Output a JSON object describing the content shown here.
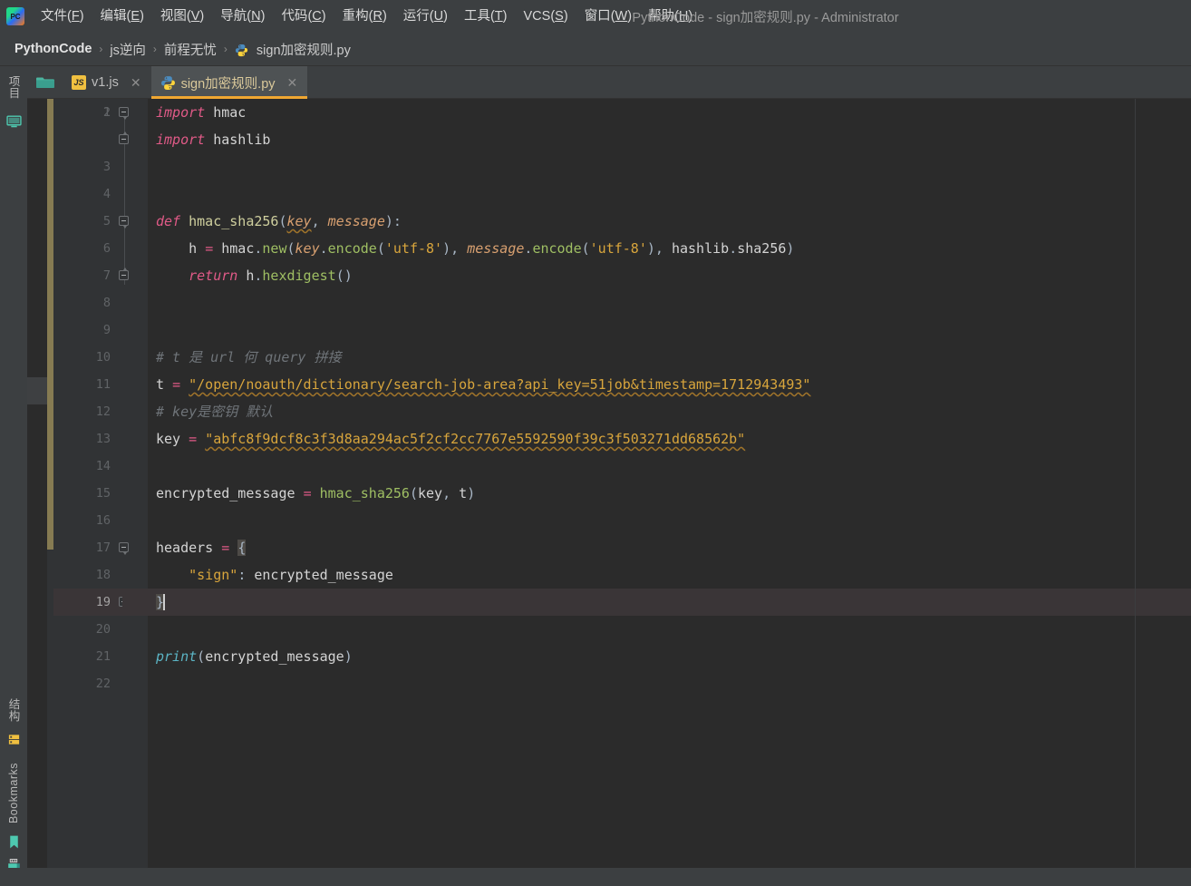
{
  "window": {
    "title": "PythonCode - sign加密规则.py - Administrator",
    "app_icon": "pycharm-logo-icon"
  },
  "menubar": {
    "items": [
      {
        "label": "文件",
        "mnemonic": "F"
      },
      {
        "label": "编辑",
        "mnemonic": "E"
      },
      {
        "label": "视图",
        "mnemonic": "V"
      },
      {
        "label": "导航",
        "mnemonic": "N"
      },
      {
        "label": "代码",
        "mnemonic": "C"
      },
      {
        "label": "重构",
        "mnemonic": "R"
      },
      {
        "label": "运行",
        "mnemonic": "U"
      },
      {
        "label": "工具",
        "mnemonic": "T"
      },
      {
        "label": "VCS",
        "mnemonic": "S"
      },
      {
        "label": "窗口",
        "mnemonic": "W"
      },
      {
        "label": "帮助",
        "mnemonic": "H"
      }
    ]
  },
  "breadcrumb": {
    "separator": "›",
    "items": [
      {
        "label": "PythonCode",
        "icon": ""
      },
      {
        "label": "js逆向",
        "icon": ""
      },
      {
        "label": "前程无忧",
        "icon": ""
      },
      {
        "label": "sign加密规则.py",
        "icon": "python-file-icon"
      }
    ]
  },
  "tabs": {
    "folder_icon": "folder-icon",
    "items": [
      {
        "label": "v1.js",
        "icon": "javascript-file-icon",
        "active": false,
        "close": "✕"
      },
      {
        "label": "sign加密规则.py",
        "icon": "python-file-icon",
        "active": true,
        "close": "✕"
      }
    ]
  },
  "left_rail": {
    "top": [
      {
        "label": "项目",
        "name": "tool-window-project"
      },
      {
        "label": "",
        "icon": "monitor-icon",
        "name": "tool-window-remote"
      }
    ],
    "bottom": [
      {
        "label": "结构",
        "name": "tool-window-structure",
        "icon": "structure-icon"
      },
      {
        "label": "Bookmarks",
        "name": "tool-window-bookmarks",
        "icon": "bookmark-icon"
      },
      {
        "label": "",
        "name": "tool-window-library",
        "icon": "books-icon"
      }
    ]
  },
  "editor": {
    "current_line": 19,
    "line_count": 22,
    "line_numbers": [
      1,
      2,
      3,
      4,
      5,
      6,
      7,
      8,
      9,
      10,
      11,
      12,
      13,
      14,
      15,
      16,
      17,
      18,
      19,
      20,
      21,
      22
    ],
    "code_lines": [
      "import hmac",
      "import hashlib",
      "",
      "",
      "def hmac_sha256(key, message):",
      "    h = hmac.new(key.encode('utf-8'), message.encode('utf-8'), hashlib.sha256)",
      "    return h.hexdigest()",
      "",
      "",
      "# t 是 url 何 query 拼接",
      "t = \"/open/noauth/dictionary/search-job-area?api_key=51job&timestamp=1712943493\"",
      "# key是密钥 默认",
      "key = \"abfc8f9dcf8c3f3d8aa294ac5f2cf2cc7767e5592590f39c3f503271dd68562b\"",
      "",
      "encrypted_message = hmac_sha256(key, t)",
      "",
      "headers = {",
      "    \"sign\": encrypted_message",
      "}",
      "",
      "print(encrypted_message)",
      ""
    ],
    "tokens": {
      "import": "import",
      "hmac": "hmac",
      "hashlib": "hashlib",
      "def": "def",
      "hmac_sha256": "hmac_sha256",
      "key_param": "key",
      "message_param": "message",
      "h_var": "h",
      "new": "new",
      "encode": "encode",
      "utf8": "'utf-8'",
      "sha256": "sha256",
      "return": "return",
      "hexdigest": "hexdigest",
      "comment_t": "# t 是 url 何 query 拼接",
      "t_var": "t",
      "url_string": "\"/open/noauth/dictionary/search-job-area?api_key=51job&timestamp=1712943493\"",
      "comment_key": "# key是密钥 默认",
      "key_var": "key",
      "key_string": "\"abfc8f9dcf8c3f3d8aa294ac5f2cf2cc7767e5592590f39c3f503271dd68562b\"",
      "encrypted_message": "encrypted_message",
      "headers": "headers",
      "sign_string": "\"sign\"",
      "print": "print",
      "open_brace": "{",
      "close_brace": "}",
      "eq": "=",
      "colon": ":",
      "lparen": "(",
      "rparen": ")",
      "comma": ","
    }
  },
  "colors": {
    "editor_bg": "#2b2b2b",
    "chrome_bg": "#3c3f41",
    "gutter_bg": "#313335",
    "current_line": "#3a3537",
    "accent_tab": "#f0a732",
    "string": "#d8a53c",
    "keyword": "#e05a87",
    "comment": "#6f7479",
    "function": "#9fbf63",
    "change_marker": "#867b52"
  }
}
